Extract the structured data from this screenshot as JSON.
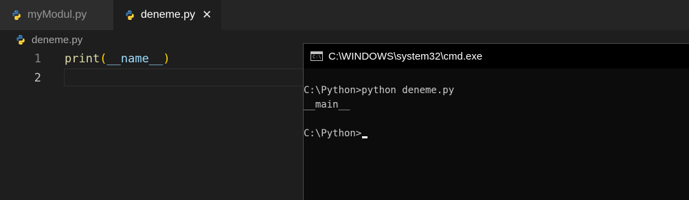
{
  "tabs": [
    {
      "label": "myModul.py",
      "icon": "python-icon",
      "active": false
    },
    {
      "label": "deneme.py",
      "icon": "python-icon",
      "active": true,
      "close": "✕"
    }
  ],
  "breadcrumb": {
    "file": "deneme.py",
    "icon": "python-icon"
  },
  "editor": {
    "lines": [
      {
        "number": "1",
        "fn": "print",
        "open": "(",
        "arg": "__name__",
        "close": ")"
      },
      {
        "number": "2",
        "text": ""
      }
    ]
  },
  "cmd": {
    "title": "C:\\WINDOWS\\system32\\cmd.exe",
    "icon_text": "C:\\",
    "lines": [
      "C:\\Python>python deneme.py",
      "__main__",
      "",
      "C:\\Python>"
    ]
  },
  "colors": {
    "python_blue": "#3572a5",
    "python_yellow": "#ffd43b",
    "function": "#dcdcaa",
    "bracket": "#ffd700",
    "variable": "#9cdcfe"
  }
}
